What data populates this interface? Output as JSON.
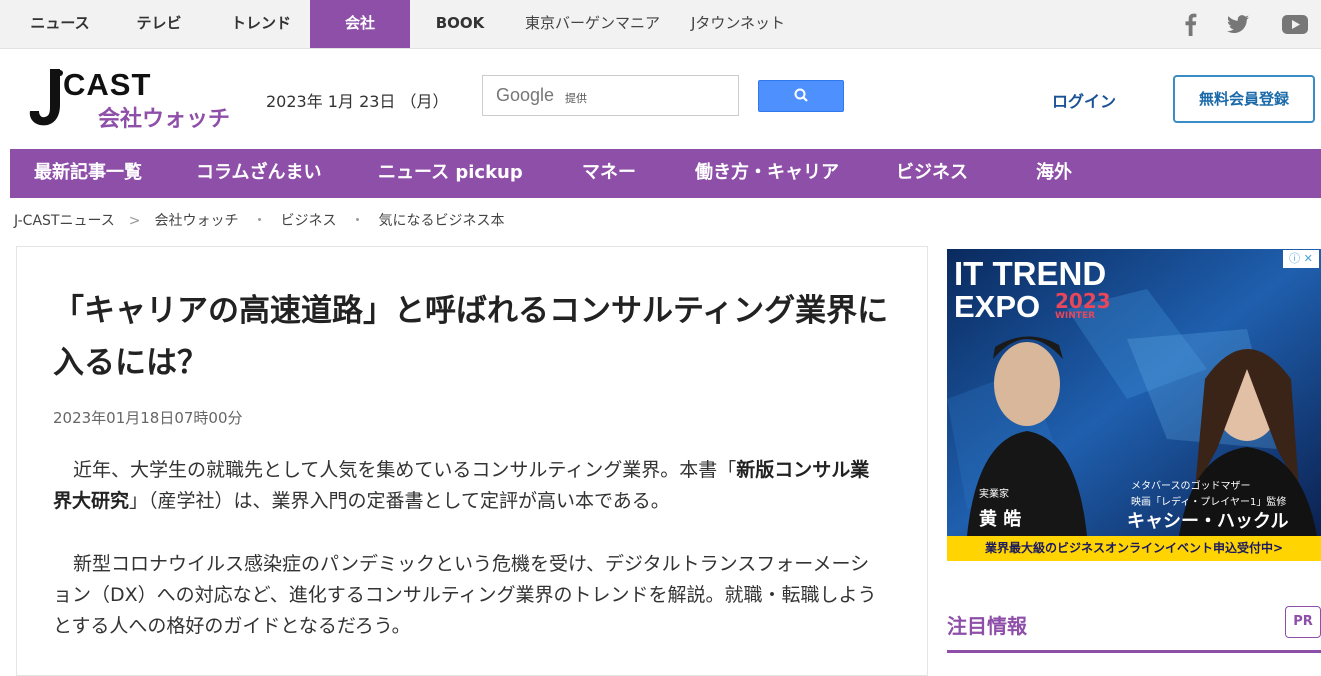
{
  "top_tabs": [
    "ニュース",
    "テレビ",
    "トレンド",
    "会社",
    "BOOK",
    "東京バーゲンマニア",
    "Jタウンネット"
  ],
  "social_icons": [
    "facebook-icon",
    "twitter-icon",
    "youtube-icon"
  ],
  "logo": {
    "main": "J CAST",
    "sub": "会社ウォッチ"
  },
  "date_text": "2023年 1月 23日 （月）",
  "search": {
    "brand": "Google",
    "provided": "提供"
  },
  "login_label": "ログイン",
  "register_label": "無料会員登録",
  "nav_items": [
    "最新記事一覧",
    "コラムざんまい",
    "ニュース pickup",
    "マネー",
    "働き方・キャリア",
    "ビジネス",
    "海外"
  ],
  "breadcrumb": [
    "J-CASTニュース",
    "会社ウォッチ",
    "ビジネス",
    "気になるビジネス本"
  ],
  "breadcrumb_seps": [
    ">",
    "・",
    "・"
  ],
  "article": {
    "title": "「キャリアの高速道路」と呼ばれるコンサルティング業界に入るには？",
    "published": "2023年01月18日07時00分",
    "p1_a": "近年、大学生の就職先として人気を集めているコンサルティング業界。本書「",
    "p1_b": "新版コンサル業界大研究",
    "p1_c": "」（産学社）は、業界入門の定番書として定評が高い本である。",
    "p2": "新型コロナウイルス感染症のパンデミックという危機を受け、デジタルトランスフォーメーション（DX）への対応など、進化するコンサルティング業界のトレンドを解説。就職・転職しようとする人への格好のガイドとなるだろう。"
  },
  "ad": {
    "title1": "IT TREND",
    "title2": "EXPO",
    "year": "2023",
    "season": "WINTER",
    "person1_role": "実業家",
    "person1_name": "黄 皓",
    "person2_role1": "メタバースのゴッドマザー",
    "person2_role2": "映画「レディ・プレイヤー1」監修",
    "person2_name": "キャシー・ハックル",
    "bottom": "業界最大級のビジネスオンラインイベント申込受付中>"
  },
  "sidebar": {
    "attention": "注目情報",
    "pr": "PR"
  },
  "colors": {
    "brand": "#8e4fa8",
    "link": "#1a5296",
    "search_button": "#4d90fe"
  }
}
